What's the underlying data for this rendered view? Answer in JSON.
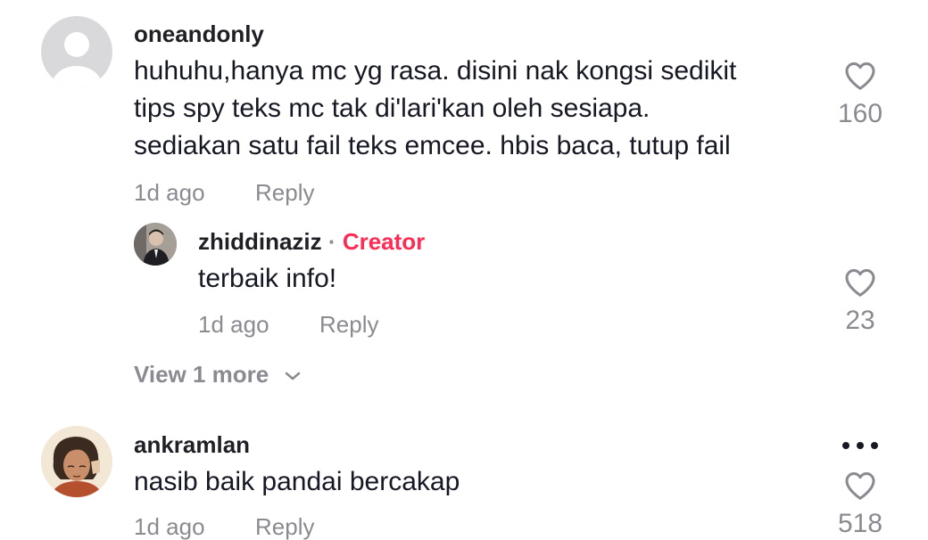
{
  "comments": [
    {
      "username": "oneandonly",
      "lines": [
        "huhuhu,hanya mc yg rasa. disini nak kongsi sedikit",
        "tips spy teks mc tak di'lari'kan oleh sesiapa.",
        "sediakan satu fail teks emcee. hbis baca, tutup fail"
      ],
      "time": "1d ago",
      "reply_label": "Reply",
      "likes": "160",
      "replies": [
        {
          "username": "zhiddinaziz",
          "separator": "·",
          "badge": "Creator",
          "text": "terbaik info!",
          "time": "1d ago",
          "reply_label": "Reply",
          "likes": "23"
        }
      ],
      "view_more_label": "View 1 more"
    },
    {
      "username": "ankramlan",
      "text": "nasib baik pandai bercakap",
      "time": "1d ago",
      "reply_label": "Reply",
      "likes": "518"
    }
  ],
  "colors": {
    "creator_badge": "#fe2c55",
    "muted_text": "#8a8b91",
    "primary_text": "#161823"
  },
  "icons": [
    "default-avatar-icon",
    "heart-icon",
    "chevron-down-icon",
    "more-options-icon"
  ]
}
